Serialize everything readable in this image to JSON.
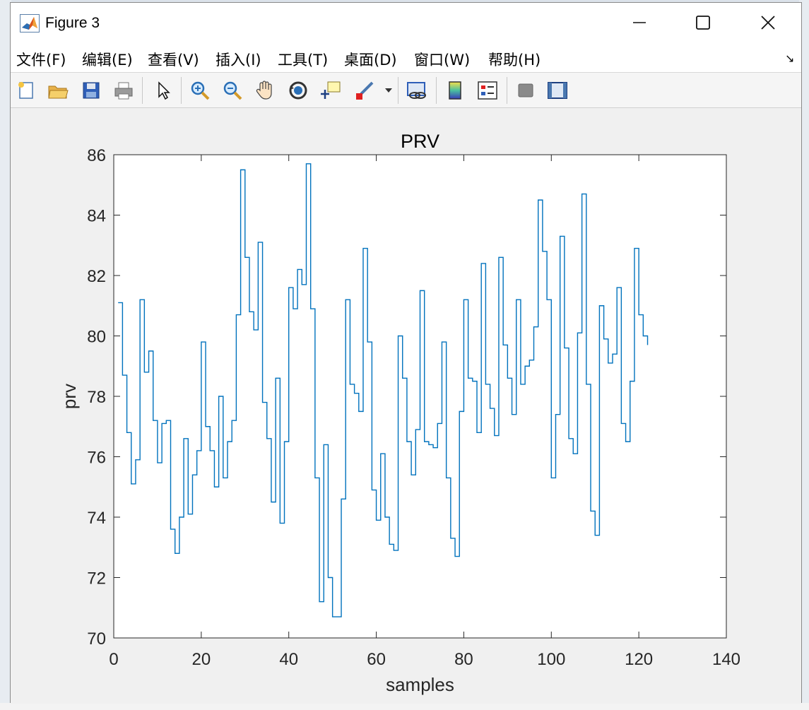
{
  "window": {
    "title": "Figure 3"
  },
  "menu": [
    {
      "label": "文件(F)"
    },
    {
      "label": "编辑(E)"
    },
    {
      "label": "查看(V)"
    },
    {
      "label": "插入(I)"
    },
    {
      "label": "工具(T)"
    },
    {
      "label": "桌面(D)"
    },
    {
      "label": "窗口(W)"
    },
    {
      "label": "帮助(H)"
    }
  ],
  "toolbar": [
    {
      "icon": "new-figure-icon"
    },
    {
      "icon": "open-file-icon"
    },
    {
      "icon": "save-icon"
    },
    {
      "icon": "print-icon"
    },
    {
      "icon": "pointer-icon"
    },
    {
      "icon": "zoom-in-icon"
    },
    {
      "icon": "zoom-out-icon"
    },
    {
      "icon": "pan-hand-icon"
    },
    {
      "icon": "rotate-3d-icon"
    },
    {
      "icon": "data-cursor-icon"
    },
    {
      "icon": "brush-icon"
    },
    {
      "icon": "link-plot-icon"
    },
    {
      "icon": "colorbar-icon"
    },
    {
      "icon": "legend-icon"
    },
    {
      "icon": "hide-plot-tools-icon"
    },
    {
      "icon": "show-plot-tools-icon"
    }
  ],
  "chart_data": {
    "type": "line",
    "style": "stairs",
    "title": "PRV",
    "xlabel": "samples",
    "ylabel": "prv",
    "xlim": [
      0,
      140
    ],
    "ylim": [
      70,
      86
    ],
    "xticks": [
      0,
      20,
      40,
      60,
      80,
      100,
      120,
      140
    ],
    "yticks": [
      70,
      72,
      74,
      76,
      78,
      80,
      82,
      84,
      86
    ],
    "grid": false,
    "line_color": "#0072BD",
    "series": [
      {
        "x": [
          1,
          2,
          3,
          4,
          5,
          6,
          7,
          8,
          9,
          10,
          11,
          12,
          13,
          14,
          15,
          16,
          17,
          18,
          19,
          20,
          21,
          22,
          23,
          24,
          25,
          26,
          27,
          28,
          29,
          30,
          31,
          32,
          33,
          34,
          35,
          36,
          37,
          38,
          39,
          40,
          41,
          42,
          43,
          44,
          45,
          46,
          47,
          48,
          49,
          50,
          51,
          52,
          53,
          54,
          55,
          56,
          57,
          58,
          59,
          60,
          61,
          62,
          63,
          64,
          65,
          66,
          67,
          68,
          69,
          70,
          71,
          72,
          73,
          74,
          75,
          76,
          77,
          78,
          79,
          80,
          81,
          82,
          83,
          84,
          85,
          86,
          87,
          88,
          89,
          90,
          91,
          92,
          93,
          94,
          95,
          96,
          97,
          98,
          99,
          100,
          101,
          102,
          103,
          104,
          105,
          106,
          107,
          108,
          109,
          110,
          111,
          112,
          113,
          114,
          115,
          116,
          117,
          118,
          119,
          120,
          121,
          122
        ],
        "y": [
          81.1,
          78.7,
          76.8,
          75.1,
          75.9,
          81.2,
          78.8,
          79.5,
          77.2,
          75.8,
          77.1,
          77.2,
          73.6,
          72.8,
          74.0,
          76.6,
          74.1,
          75.4,
          76.2,
          79.8,
          77.0,
          76.2,
          75.0,
          78.0,
          75.3,
          76.5,
          77.2,
          80.7,
          85.5,
          82.6,
          80.8,
          80.2,
          83.1,
          77.8,
          76.6,
          74.5,
          78.6,
          73.8,
          76.5,
          81.6,
          80.9,
          82.2,
          81.7,
          85.7,
          80.9,
          75.3,
          71.2,
          76.4,
          72.0,
          70.7,
          70.7,
          74.6,
          81.2,
          78.4,
          78.1,
          77.5,
          82.9,
          79.8,
          74.9,
          73.9,
          76.1,
          74.0,
          73.1,
          72.9,
          80.0,
          78.6,
          76.5,
          75.4,
          76.9,
          81.5,
          76.5,
          76.4,
          76.3,
          77.1,
          79.8,
          75.3,
          73.3,
          72.7,
          77.5,
          81.2,
          78.6,
          78.5,
          76.8,
          82.4,
          78.4,
          77.6,
          76.7,
          82.6,
          79.7,
          78.6,
          77.4,
          81.2,
          78.4,
          79.0,
          79.2,
          80.3,
          84.5,
          82.8,
          81.2,
          75.3,
          77.4,
          83.3,
          79.6,
          76.6,
          76.1,
          80.1,
          84.7,
          78.4,
          74.2,
          73.4,
          81.0,
          79.9,
          79.1,
          79.4,
          81.6,
          77.1,
          76.5,
          78.5,
          82.9,
          80.7,
          80.0,
          79.7
        ]
      }
    ]
  }
}
